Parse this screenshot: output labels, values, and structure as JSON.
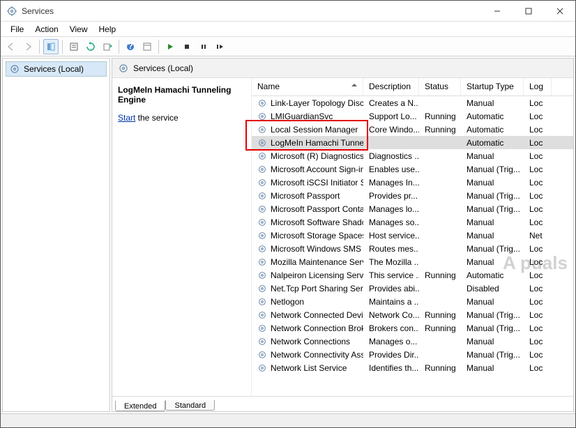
{
  "window": {
    "title": "Services"
  },
  "menubar": [
    "File",
    "Action",
    "View",
    "Help"
  ],
  "nav": {
    "item": "Services (Local)"
  },
  "panel": {
    "title": "Services (Local)"
  },
  "action_pane": {
    "heading": "LogMeIn Hamachi Tunneling Engine",
    "link_text": "Start",
    "after_link": " the service"
  },
  "columns": {
    "name": "Name",
    "description": "Description",
    "status": "Status",
    "startup": "Startup Type",
    "logon": "Log"
  },
  "tabs": {
    "extended": "Extended",
    "standard": "Standard"
  },
  "services": [
    {
      "name": "Link-Layer Topology Discov...",
      "desc": "Creates a N...",
      "status": "",
      "startup": "Manual",
      "logon": "Loc"
    },
    {
      "name": "LMIGuardianSvc",
      "desc": "Support Lo...",
      "status": "Running",
      "startup": "Automatic",
      "logon": "Loc"
    },
    {
      "name": "Local Session Manager",
      "desc": "Core Windo...",
      "status": "Running",
      "startup": "Automatic",
      "logon": "Loc"
    },
    {
      "name": "LogMeIn Hamachi Tunneli...",
      "desc": "",
      "status": "",
      "startup": "Automatic",
      "logon": "Loc",
      "selected": true
    },
    {
      "name": "Microsoft (R) Diagnostics H...",
      "desc": "Diagnostics ...",
      "status": "",
      "startup": "Manual",
      "logon": "Loc"
    },
    {
      "name": "Microsoft Account Sign-in ...",
      "desc": "Enables use...",
      "status": "",
      "startup": "Manual (Trig...",
      "logon": "Loc"
    },
    {
      "name": "Microsoft iSCSI Initiator Ser...",
      "desc": "Manages In...",
      "status": "",
      "startup": "Manual",
      "logon": "Loc"
    },
    {
      "name": "Microsoft Passport",
      "desc": "Provides pr...",
      "status": "",
      "startup": "Manual (Trig...",
      "logon": "Loc"
    },
    {
      "name": "Microsoft Passport Container",
      "desc": "Manages lo...",
      "status": "",
      "startup": "Manual (Trig...",
      "logon": "Loc"
    },
    {
      "name": "Microsoft Software Shadow...",
      "desc": "Manages so...",
      "status": "",
      "startup": "Manual",
      "logon": "Loc"
    },
    {
      "name": "Microsoft Storage Spaces S...",
      "desc": "Host service...",
      "status": "",
      "startup": "Manual",
      "logon": "Net"
    },
    {
      "name": "Microsoft Windows SMS Ro...",
      "desc": "Routes mes...",
      "status": "",
      "startup": "Manual (Trig...",
      "logon": "Loc"
    },
    {
      "name": "Mozilla Maintenance Service",
      "desc": "The Mozilla ...",
      "status": "",
      "startup": "Manual",
      "logon": "Loc"
    },
    {
      "name": "Nalpeiron Licensing Service",
      "desc": "This service ...",
      "status": "Running",
      "startup": "Automatic",
      "logon": "Loc"
    },
    {
      "name": "Net.Tcp Port Sharing Service",
      "desc": "Provides abi...",
      "status": "",
      "startup": "Disabled",
      "logon": "Loc"
    },
    {
      "name": "Netlogon",
      "desc": "Maintains a ...",
      "status": "",
      "startup": "Manual",
      "logon": "Loc"
    },
    {
      "name": "Network Connected Device...",
      "desc": "Network Co...",
      "status": "Running",
      "startup": "Manual (Trig...",
      "logon": "Loc"
    },
    {
      "name": "Network Connection Broker",
      "desc": "Brokers con...",
      "status": "Running",
      "startup": "Manual (Trig...",
      "logon": "Loc"
    },
    {
      "name": "Network Connections",
      "desc": "Manages o...",
      "status": "",
      "startup": "Manual",
      "logon": "Loc"
    },
    {
      "name": "Network Connectivity Assis...",
      "desc": "Provides Dir...",
      "status": "",
      "startup": "Manual (Trig...",
      "logon": "Loc"
    },
    {
      "name": "Network List Service",
      "desc": "Identifies th...",
      "status": "Running",
      "startup": "Manual",
      "logon": "Loc"
    }
  ],
  "watermark": "A   puals"
}
